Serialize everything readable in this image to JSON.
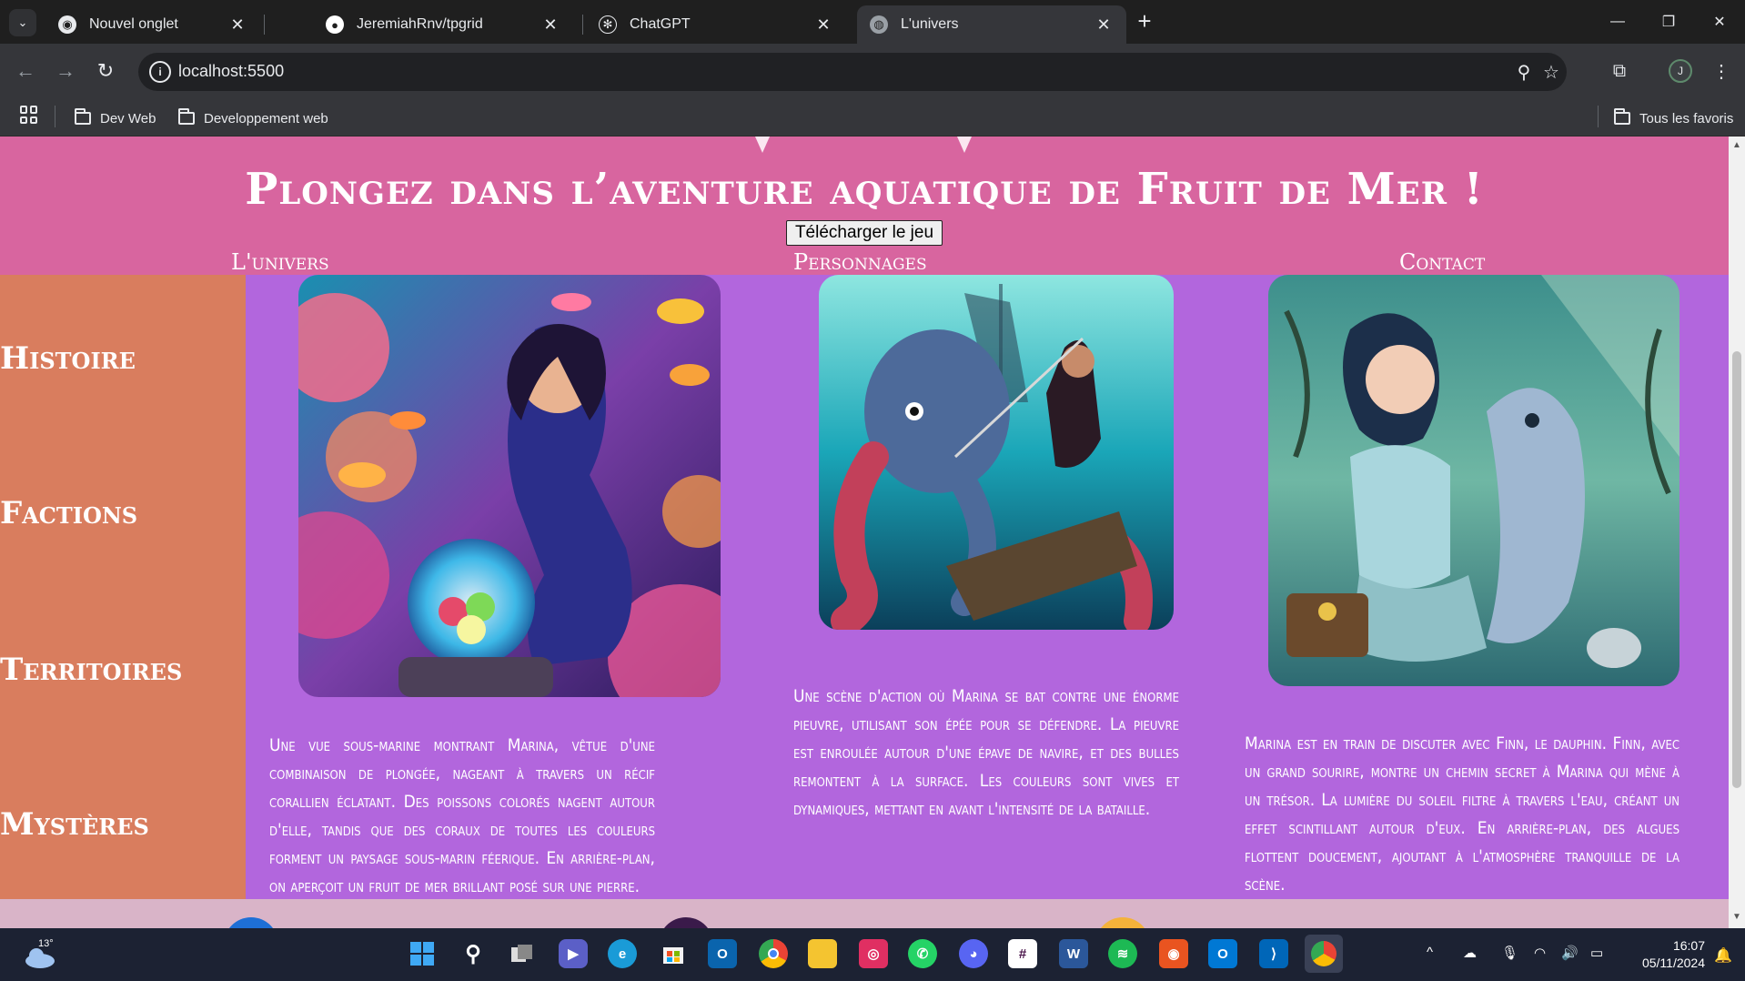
{
  "browser": {
    "tabs": [
      {
        "label": "Nouvel onglet",
        "icon": "chrome-icon",
        "active": false
      },
      {
        "label": "JeremiahRnv/tpgrid",
        "icon": "github-icon",
        "active": false
      },
      {
        "label": "ChatGPT",
        "icon": "chatgpt-icon",
        "active": false
      },
      {
        "label": "L'univers",
        "icon": "globe-icon",
        "active": true
      }
    ],
    "url": "localhost:5500",
    "bookmarks": [
      "Dev Web",
      "Developpement web"
    ],
    "all_bookmarks_label": "Tous les favoris",
    "profile_initial": "J"
  },
  "site": {
    "title": "Plongez dans l’aventure aquatique de Fruit de Mer !",
    "download_button": "Télécharger le jeu",
    "nav": [
      "L'univers",
      "Personnages",
      "Contact"
    ],
    "sidebar": [
      "Histoire",
      "Factions",
      "Territoires",
      "Mystères"
    ],
    "cards": [
      {
        "image": "marina-coral-reef-image",
        "text": "Une vue sous-marine montrant Marina, vêtue d'une combinaison de plongée, nageant à travers un récif corallien éclatant. Des poissons colorés nagent autour d'elle, tandis que des coraux de toutes les couleurs forment un paysage sous-marin féerique. En arrière-plan, on aperçoit un fruit de mer brillant posé sur une pierre."
      },
      {
        "image": "marina-octopus-battle-image",
        "text": "Une scène d'action où Marina se bat contre une énorme pieuvre, utilisant son épée pour se défendre. La pieuvre est enroulée autour d'une épave de navire, et des bulles remontent à la surface. Les couleurs sont vives et dynamiques, mettant en avant l'intensité de la bataille."
      },
      {
        "image": "marina-dolphin-image",
        "text": "Marina est en train de discuter avec Finn, le dauphin. Finn, avec un grand sourire, montre un chemin secret à Marina qui mène à un trésor. La lumière du soleil filtre à travers l'eau, créant un effet scintillant autour d'eux. En arrière-plan, des algues flottent doucement, ajoutant à l'atmosphère tranquille de la scène."
      }
    ],
    "colors": {
      "header": "#d8659f",
      "sidebar": "#d97d5e",
      "main": "#b266dd"
    }
  },
  "taskbar": {
    "weather_temp": "13°",
    "time": "16:07",
    "date": "05/11/2024",
    "apps": [
      "start-icon",
      "search-icon",
      "task-view-icon",
      "teams-icon",
      "edge-icon",
      "store-icon",
      "outlook-icon",
      "chrome-icon",
      "file-explorer-icon",
      "creative-cloud-icon",
      "whatsapp-icon",
      "discord-icon",
      "slack-icon",
      "word-icon",
      "spotify-icon",
      "ubuntu-icon",
      "outlook-new-icon",
      "vscode-icon",
      "chrome-profile-icon"
    ]
  }
}
